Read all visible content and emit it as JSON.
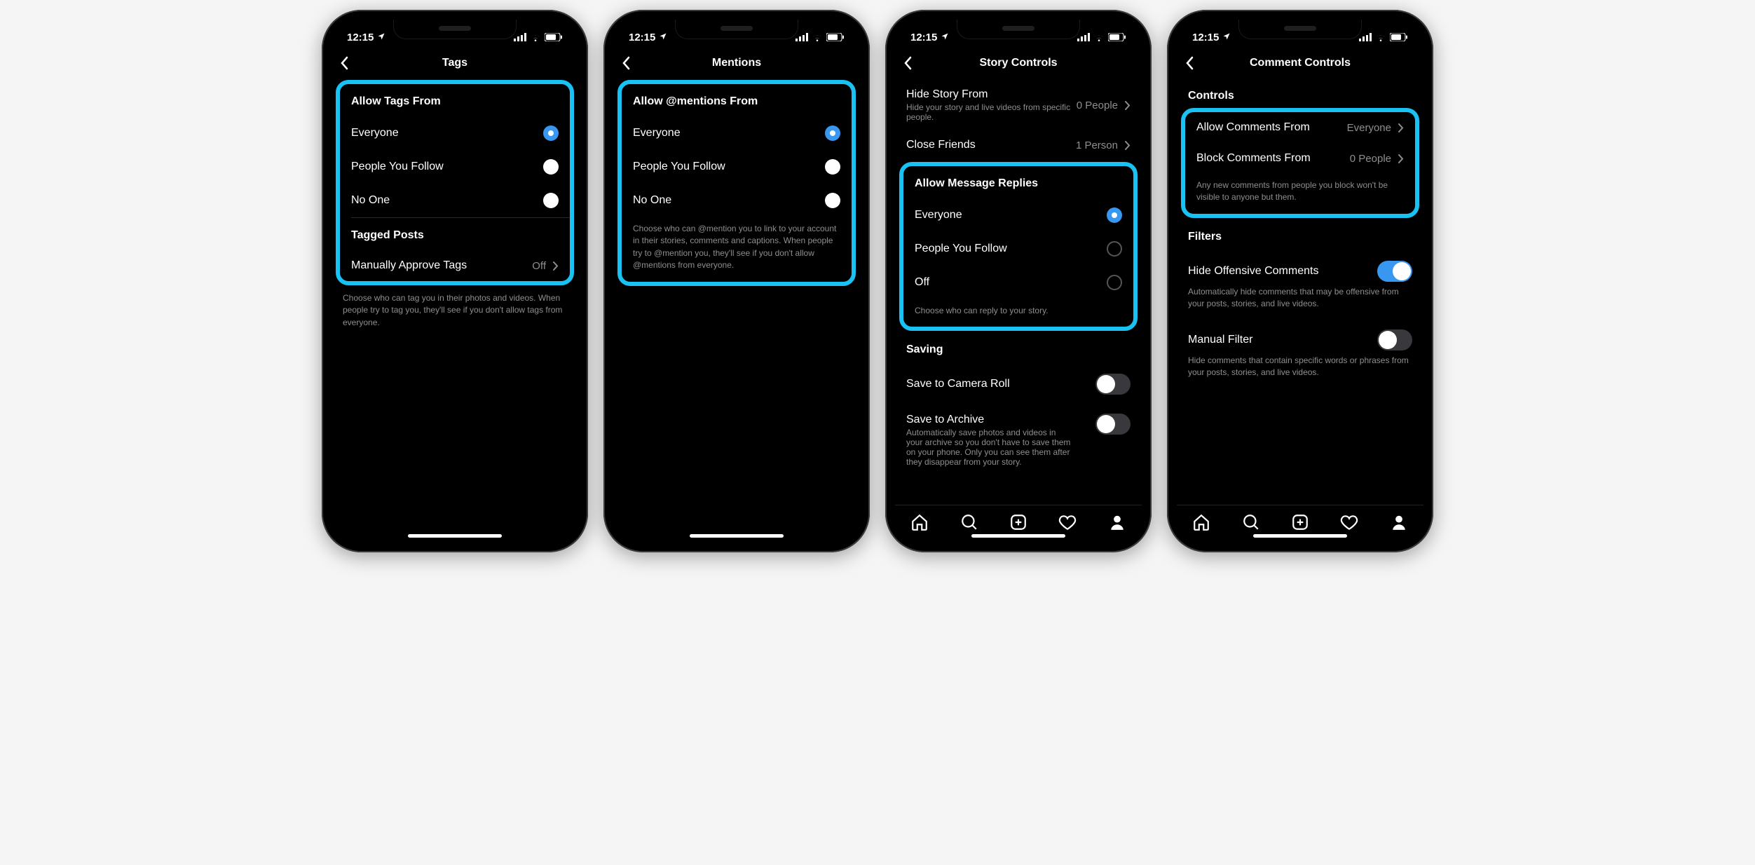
{
  "status": {
    "time": "12:15"
  },
  "screens": [
    {
      "title": "Tags",
      "highlight": {
        "header": "Allow Tags From",
        "options": [
          "Everyone",
          "People You Follow",
          "No One"
        ],
        "selected": 0,
        "radio_style": "filled",
        "sub_header": "Tagged Posts",
        "sub_row": {
          "label": "Manually Approve Tags",
          "value": "Off"
        }
      },
      "helper": "Choose who can tag you in their photos and videos. When people try to tag you, they'll see if you don't allow tags from everyone.",
      "tabbar": false
    },
    {
      "title": "Mentions",
      "highlight": {
        "header": "Allow @mentions From",
        "options": [
          "Everyone",
          "People You Follow",
          "No One"
        ],
        "selected": 0,
        "radio_style": "filled",
        "bottom_helper": "Choose who can @mention you to link to your account in their stories, comments and captions. When people try to @mention you, they'll see if you don't allow @mentions from everyone."
      },
      "tabbar": false
    },
    {
      "title": "Story Controls",
      "above": [
        {
          "label": "Hide Story From",
          "value": "0 People",
          "sub": "Hide your story and live videos from specific people."
        },
        {
          "label": "Close Friends",
          "value": "1 Person"
        }
      ],
      "highlight": {
        "header": "Allow Message Replies",
        "options": [
          "Everyone",
          "People You Follow",
          "Off"
        ],
        "selected": 0,
        "radio_style": "outline",
        "bottom_helper": "Choose who can reply to your story."
      },
      "below_header": "Saving",
      "below_rows": [
        {
          "label": "Save to Camera Roll",
          "toggle": false
        },
        {
          "label": "Save to Archive",
          "toggle": false,
          "sub": "Automatically save photos and videos in your archive so you don't have to save them on your phone. Only you can see them after they disappear from your story."
        }
      ],
      "tabbar": true
    },
    {
      "title": "Comment Controls",
      "plain_header": "Controls",
      "highlight_rows": [
        {
          "label": "Allow Comments From",
          "value": "Everyone"
        },
        {
          "label": "Block Comments From",
          "value": "0 People"
        }
      ],
      "highlight_helper": "Any new comments from people you block won't be visible to anyone but them.",
      "filters_header": "Filters",
      "filters": [
        {
          "label": "Hide Offensive Comments",
          "toggle": true,
          "sub": "Automatically hide comments that may be offensive from your posts, stories, and live videos."
        },
        {
          "label": "Manual Filter",
          "toggle": false,
          "sub": "Hide comments that contain specific words or phrases from your posts, stories, and live videos."
        }
      ],
      "tabbar": true
    }
  ]
}
